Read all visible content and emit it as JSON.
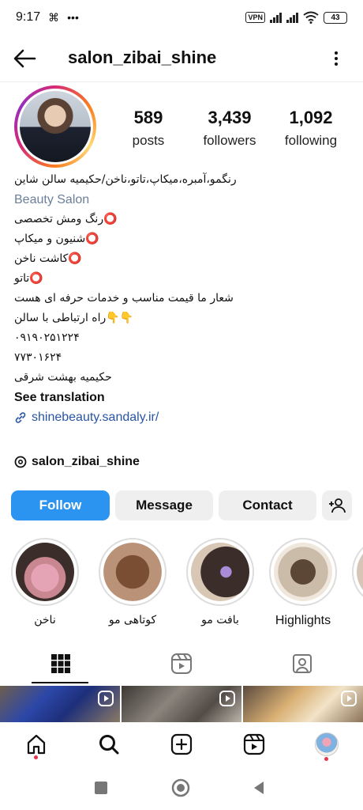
{
  "status_bar": {
    "time": "9:17",
    "vpn": "VPN",
    "battery": "43"
  },
  "header": {
    "username": "salon_zibai_shine"
  },
  "stats": {
    "posts_count": "589",
    "posts_label": "posts",
    "followers_count": "3,439",
    "followers_label": "followers",
    "following_count": "1,092",
    "following_label": "following"
  },
  "bio": {
    "name_line": "رنگمو،آمبره،میکاپ،تاتو،ناخن/حکیمیه سالن شاین",
    "category": "Beauty Salon",
    "lines": [
      "⭕رنگ ومش تخصصی",
      "⭕شنیون و میکاپ",
      "⭕کاشت ناخن",
      "⭕تاتو",
      "شعار ما قیمت مناسب و خدمات حرفه ای هست",
      "👇👇راه ارتباطی با سالن",
      "۰۹۱۹۰۲۵۱۲۲۴",
      "۷۷۳۰۱۶۲۴",
      "حکیمیه بهشت شرقی"
    ],
    "see_translation": "See translation",
    "link": "shinebeauty.sandaly.ir/",
    "threads_handle": "salon_zibai_shine"
  },
  "actions": {
    "follow": "Follow",
    "message": "Message",
    "contact": "Contact"
  },
  "highlights": [
    {
      "label": "ناخن"
    },
    {
      "label": "کوتاهی مو"
    },
    {
      "label": "بافت مو"
    },
    {
      "label": "Highlights"
    }
  ],
  "colors": {
    "accent": "#2b93f0",
    "link": "#2855a3",
    "notification_dot": "#e5334d"
  },
  "icons": {
    "tabs": [
      "grid-icon",
      "reels-icon",
      "tagged-icon"
    ],
    "bottom_nav": [
      "home-icon",
      "search-icon",
      "create-icon",
      "reels-icon",
      "profile-avatar"
    ]
  }
}
